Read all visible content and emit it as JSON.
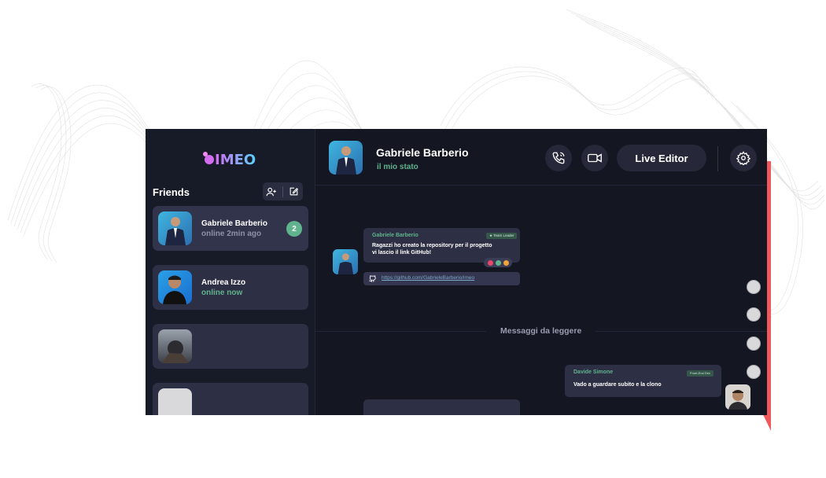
{
  "colors": {
    "background": "#141622",
    "sidebar": "#171a27",
    "card": "#2d2f44",
    "accent_green": "#5fb38d",
    "accent_red": "#f0595c",
    "status_gray": "#8e90a8"
  },
  "sidebar": {
    "logo_text": "IMEO",
    "friends_title": "Friends",
    "add_friend_icon": "add-user-icon",
    "compose_icon": "edit-icon",
    "friends": [
      {
        "name": "Gabriele Barberio",
        "status": "online 2min ago",
        "status_color": "#8e90a8",
        "unread": "2",
        "active": true
      },
      {
        "name": "Andrea Izzo",
        "status": "online now",
        "status_color": "#5fb38d",
        "unread": "",
        "active": false
      },
      {
        "name": "",
        "status": "",
        "unread": "",
        "active": false
      },
      {
        "name": "",
        "status": "",
        "unread": "",
        "active": false
      }
    ]
  },
  "header": {
    "name": "Gabriele Barberio",
    "status": "il mio stato",
    "call_icon": "phone-call-icon",
    "video_icon": "video-camera-icon",
    "live_editor_label": "Live Editor",
    "settings_icon": "gear-icon"
  },
  "messages": [
    {
      "author": "Gabriele Barberio",
      "role": "★ Team Leader",
      "text_line1": "Ragazzi ho creato la repository per il progetto",
      "text_line2": "vi lascio il link GitHub!",
      "reactions": [
        "heart",
        "check",
        "thumbs-up"
      ],
      "link": "https://github.com/GabrieleBarberio/imeo"
    },
    {
      "author": "Davide Simone",
      "role": "Front-End Dev",
      "text_line1": "Vado a guardare subito e la clono"
    }
  ],
  "unread_divider": "Messaggi da leggere"
}
